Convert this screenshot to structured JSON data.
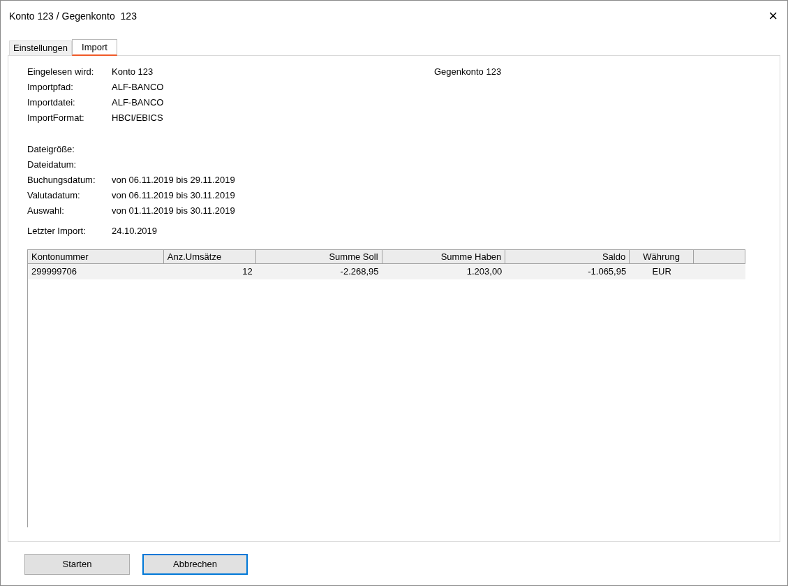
{
  "window": {
    "title": "Konto 123 / Gegenkonto  123",
    "close": "×"
  },
  "tabs": [
    {
      "label": "Einstellungen",
      "selected": false
    },
    {
      "label": "Import",
      "selected": true
    }
  ],
  "info_groups": [
    [
      {
        "label": "Eingelesen wird:",
        "value": "Konto 123",
        "value_2": "Gegenkonto 123"
      },
      {
        "label": "Importpfad:",
        "value": "ALF-BANCO"
      },
      {
        "label": "Importdatei:",
        "value": "ALF-BANCO"
      },
      {
        "label": "ImportFormat:",
        "value": "HBCI/EBICS"
      }
    ],
    [
      {
        "label": "Dateigröße:"
      },
      {
        "label": "Dateidatum:"
      },
      {
        "label": "Buchungsdatum:",
        "value": "von 06.11.2019 bis 29.11.2019"
      },
      {
        "label": "Valutadatum:",
        "value": "von 06.11.2019 bis 30.11.2019"
      },
      {
        "label": "Auswahl:",
        "value": "von 01.11.2019 bis 30.11.2019"
      }
    ],
    [
      {
        "label": "Letzter Import:",
        "value": "24.10.2019"
      }
    ]
  ],
  "table": {
    "columns": [
      "Kontonummer",
      "Anz.Umsätze",
      "Summe Soll",
      "Summe Haben",
      "Saldo",
      "Währung"
    ],
    "rows": [
      [
        "299999706",
        "12",
        "-2.268,95",
        "1.203,00",
        "-1.065,95",
        "EUR"
      ]
    ]
  },
  "buttons": [
    {
      "label": "Starten",
      "focused": false
    },
    {
      "label": "Abbrechen",
      "focused": true
    }
  ]
}
